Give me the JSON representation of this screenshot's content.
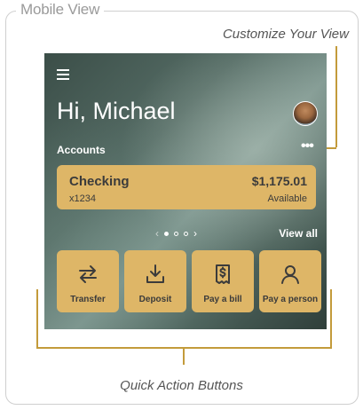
{
  "frame": {
    "title": "Mobile View"
  },
  "callouts": {
    "customize": "Customize Your View",
    "quick_actions": "Quick Action Buttons"
  },
  "app": {
    "greeting": "Hi, Michael",
    "accounts_label": "Accounts",
    "more_menu": "•••",
    "account": {
      "name": "Checking",
      "number": "x1234",
      "balance": "$1,175.01",
      "balance_label": "Available"
    },
    "pager": {
      "prev": "‹",
      "next": "›",
      "current": 1,
      "total": 3
    },
    "view_all": "View all",
    "actions": [
      {
        "label": "Transfer",
        "icon": "transfer-icon"
      },
      {
        "label": "Deposit",
        "icon": "deposit-icon"
      },
      {
        "label": "Pay a bill",
        "icon": "bill-icon"
      },
      {
        "label": "Pay a person",
        "icon": "person-icon"
      }
    ]
  },
  "colors": {
    "accent": "#deb667",
    "callout_line": "#c39b3b"
  }
}
